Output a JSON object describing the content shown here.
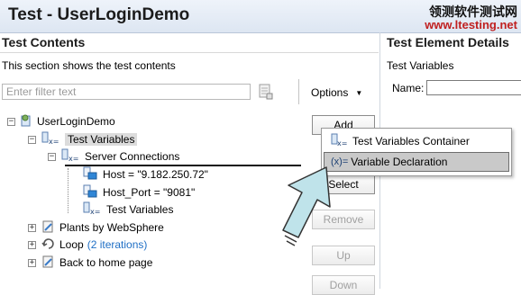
{
  "window": {
    "title": "Test - UserLoginDemo",
    "watermark_cn": "领测软件测试网",
    "watermark_url": "www.ltesting.net"
  },
  "test_contents": {
    "heading": "Test Contents",
    "description": "This section shows the test contents",
    "filter_placeholder": "Enter filter text",
    "options_label": "Options"
  },
  "test_element_details": {
    "heading": "Test Element Details",
    "subheading": "Test Variables",
    "name_label": "Name:",
    "name_value": ""
  },
  "tree": {
    "root": "UserLoginDemo",
    "test_variables": "Test Variables",
    "server_connections": "Server Connections",
    "host": "Host = \"9.182.250.72\"",
    "host_port": "Host_Port = \"9081\"",
    "nested_test_variables": "Test Variables",
    "plants": "Plants by WebSphere",
    "loop": "Loop",
    "loop_iterations": "(2 iterations)",
    "back_home": "Back to home page"
  },
  "buttons": {
    "add": "Add",
    "select": "Select",
    "remove": "Remove",
    "up": "Up",
    "down": "Down"
  },
  "add_menu": {
    "items": [
      "Test Variables Container",
      "Variable Declaration"
    ],
    "selected": "Variable Declaration"
  },
  "colors": {
    "accent": "#1f6fc5",
    "arrow_fill": "#bfe3ea",
    "selection": "#c9c9c9"
  }
}
